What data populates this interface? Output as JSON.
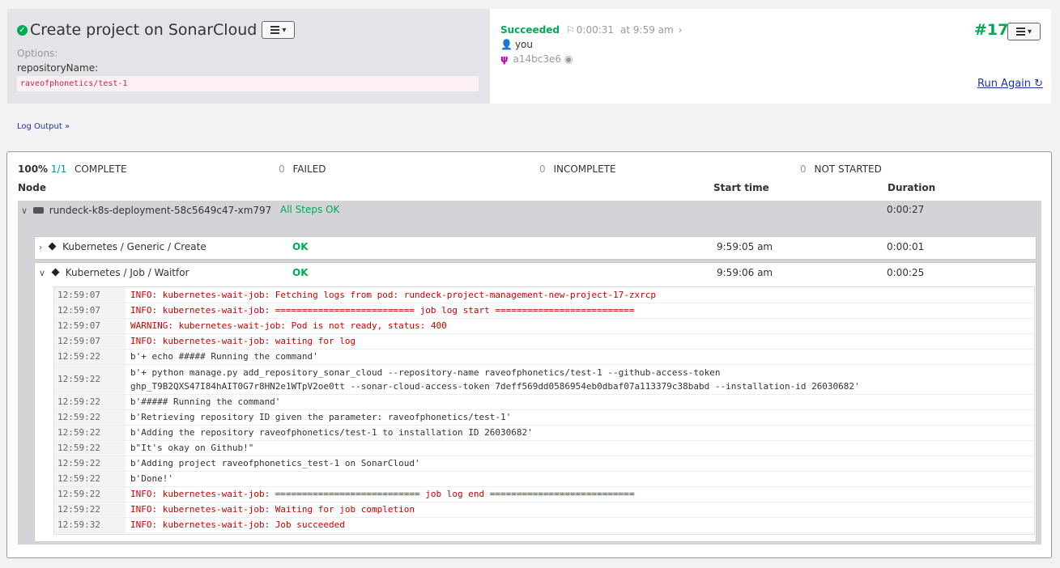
{
  "job": {
    "title": "Create project on SonarCloud",
    "options_label": "Options:",
    "option_name": "repositoryName:",
    "option_value": "raveofphonetics/test-1"
  },
  "execution": {
    "status": "Succeeded",
    "duration": "0:00:31",
    "time": "at 9:59 am",
    "user": "you",
    "node_hash": "a14bc3e6",
    "number": "#17",
    "run_again": "Run Again"
  },
  "log_output_link": "Log Output »",
  "summary": {
    "percent": "100%",
    "ratio": "1/1",
    "complete_label": "COMPLETE",
    "failed_count": "0",
    "failed_label": "FAILED",
    "incomplete_count": "0",
    "incomplete_label": "INCOMPLETE",
    "notstarted_count": "0",
    "notstarted_label": "NOT STARTED"
  },
  "columns": {
    "node": "Node",
    "start": "Start time",
    "duration": "Duration"
  },
  "node": {
    "name": "rundeck-k8s-deployment-58c5649c47-xm797",
    "status": "All Steps OK",
    "duration": "0:00:27"
  },
  "steps": [
    {
      "name": "Kubernetes / Generic / Create",
      "status": "OK",
      "start": "9:59:05 am",
      "duration": "0:00:01"
    },
    {
      "name": "Kubernetes / Job / Waitfor",
      "status": "OK",
      "start": "9:59:06 am",
      "duration": "0:00:25"
    }
  ],
  "log_lines": [
    {
      "time": "12:59:07",
      "text": "INFO: kubernetes-wait-job: Fetching logs from pod: rundeck-project-management-new-project-17-zxrcp",
      "level": "err"
    },
    {
      "time": "12:59:07",
      "text": "INFO: kubernetes-wait-job: ========================== job log start ==========================",
      "level": "err"
    },
    {
      "time": "12:59:07",
      "text": "WARNING: kubernetes-wait-job: Pod is not ready, status: 400",
      "level": "err"
    },
    {
      "time": "12:59:07",
      "text": "INFO: kubernetes-wait-job: waiting for log",
      "level": "err"
    },
    {
      "time": "12:59:22",
      "text": "b'+ echo ##### Running the command'",
      "level": "normal"
    },
    {
      "time": "12:59:22",
      "text": "b'+ python manage.py add_repository_sonar_cloud --repository-name raveofphonetics/test-1 --github-access-token",
      "text2": "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 --sonar-cloud-access-token 7deff569dd0586954eb0dbaf07a113379c38babd --installation-id 26030682'",
      "level": "normal"
    },
    {
      "time": "12:59:22",
      "text": "b'##### Running the command'",
      "level": "normal"
    },
    {
      "time": "12:59:22",
      "text": "b'Retrieving repository ID given the parameter: raveofphonetics/test-1'",
      "level": "normal"
    },
    {
      "time": "12:59:22",
      "text": "b'Adding the repository raveofphonetics/test-1 to installation ID 26030682'",
      "level": "normal"
    },
    {
      "time": "12:59:22",
      "text": "b\"It's okay on Github!\"",
      "level": "normal"
    },
    {
      "time": "12:59:22",
      "text": "b'Adding project raveofphonetics_test-1 on SonarCloud'",
      "level": "normal"
    },
    {
      "time": "12:59:22",
      "text": "b'Done!'",
      "level": "normal"
    },
    {
      "time": "12:59:22",
      "text": "INFO: kubernetes-wait-job: =========================== job log end ===========================",
      "level": "err"
    },
    {
      "time": "12:59:22",
      "text": "INFO: kubernetes-wait-job: Waiting for job completion",
      "level": "err"
    },
    {
      "time": "12:59:32",
      "text": "INFO: kubernetes-wait-job: Job succeeded",
      "level": "err"
    }
  ],
  "colors": {
    "success": "#00aa55",
    "error": "#cc0000",
    "link": "#2233aa"
  },
  "icons": [
    "ok-circle-icon",
    "list-menu-icon",
    "flag-icon",
    "chevron-right-icon",
    "user-icon",
    "node-fork-icon",
    "target-icon",
    "refresh-icon",
    "server-icon",
    "diamond-icon",
    "chevron-down-icon"
  ]
}
